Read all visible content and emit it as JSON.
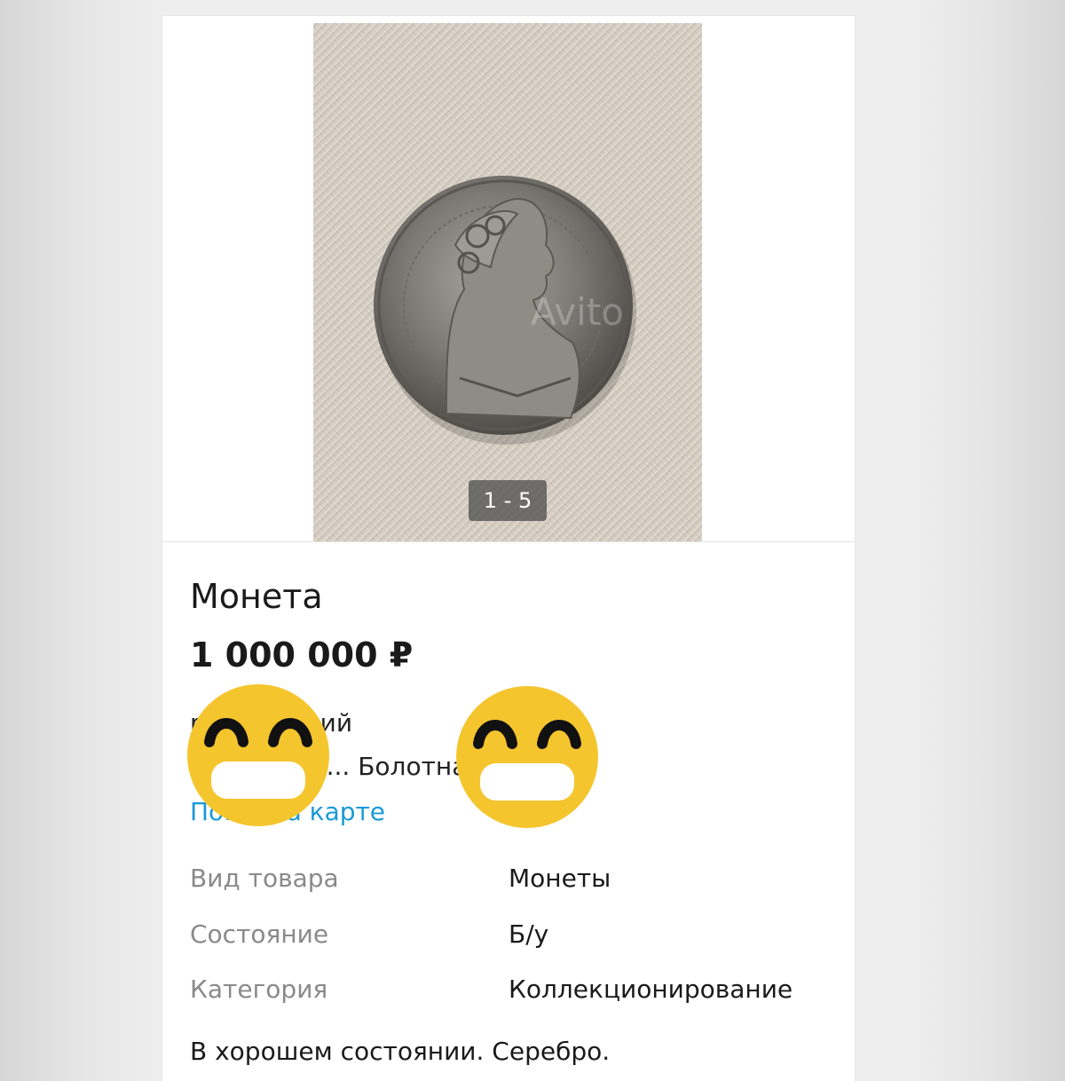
{
  "listing": {
    "photo_counter": "1 - 5",
    "photo_watermark": "Avito",
    "title": "Монета",
    "price": "1 000 000 ₽",
    "address_line1": "р... ...рьский",
    "address_line2": "...я област... Болотная ул.",
    "map_link": "По...ь на карте",
    "properties": [
      {
        "key": "Вид товара",
        "value": "Монеты"
      },
      {
        "key": "Состояние",
        "value": "Б/у"
      },
      {
        "key": "Категория",
        "value": "Коллекционирование"
      }
    ],
    "description": "В хорошем состоянии. Серебро."
  },
  "colors": {
    "link": "#1a9ad9",
    "emoji_face": "#f5c52e",
    "muted_label": "#8a8a8a"
  },
  "icons": [
    "grinning-emoji-icon",
    "grinning-emoji-icon"
  ]
}
